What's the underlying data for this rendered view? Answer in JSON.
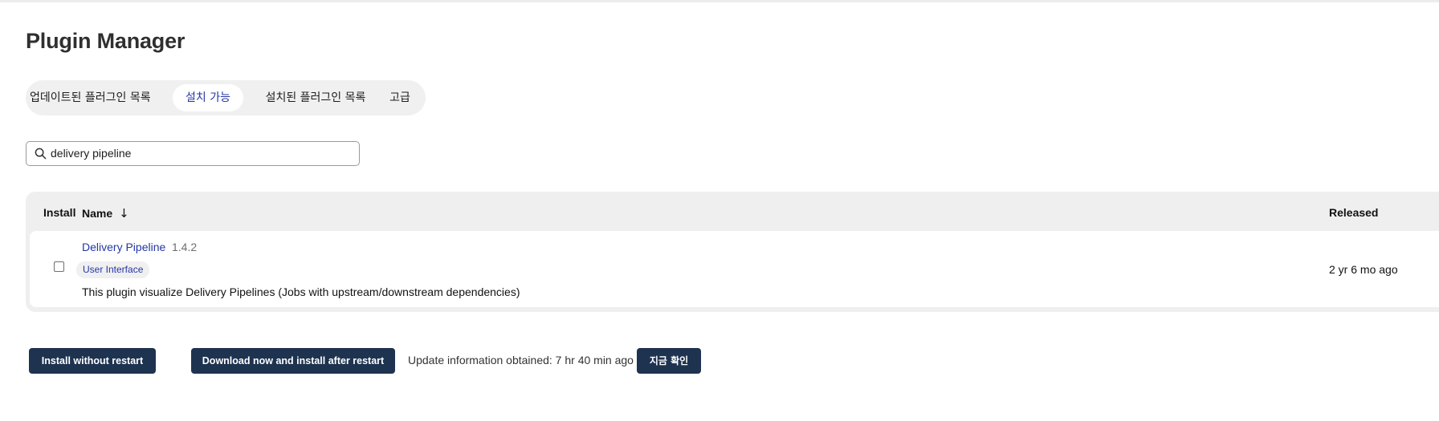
{
  "page": {
    "title": "Plugin Manager"
  },
  "tabs": [
    {
      "label": "업데이트된 플러그인 목록",
      "active": false
    },
    {
      "label": "설치 가능",
      "active": true
    },
    {
      "label": "설치된 플러그인 목록",
      "active": false
    },
    {
      "label": "고급",
      "active": false
    }
  ],
  "search": {
    "value": "delivery pipeline",
    "icon": "search-icon"
  },
  "table": {
    "headers": {
      "install": "Install",
      "name": "Name",
      "sort_indicator": "↓",
      "released": "Released"
    },
    "rows": [
      {
        "checked": false,
        "name": "Delivery Pipeline",
        "version": "1.4.2",
        "category": "User Interface",
        "description": "This plugin visualize Delivery Pipelines (Jobs with upstream/downstream dependencies)",
        "released": "2 yr 6 mo ago"
      }
    ]
  },
  "footer": {
    "install_without_restart": "Install without restart",
    "download_install_after_restart": "Download now and install after restart",
    "update_info": "Update information obtained: 7 hr 40 min ago",
    "check_now": "지금 확인"
  },
  "colors": {
    "accent": "#2436a6",
    "button_bg": "#1e3350",
    "tab_bar_bg": "#f0f0f0"
  }
}
